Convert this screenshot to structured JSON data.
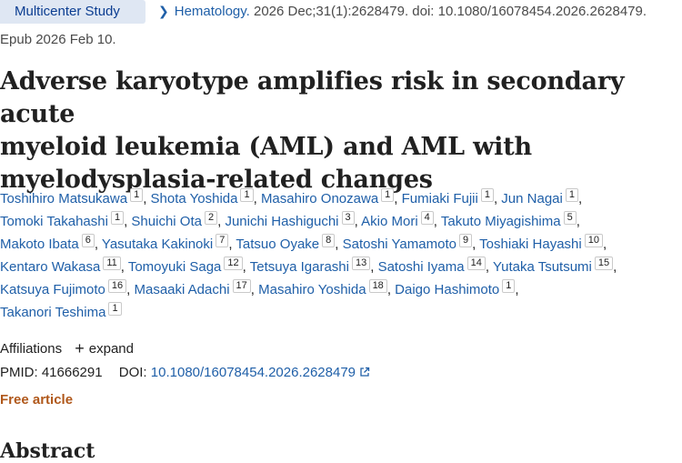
{
  "header": {
    "badge": "Multicenter Study",
    "journal": "Hematology.",
    "citation": " 2026 Dec;31(1):2628479. doi: 10.1080/16078454.2026.2628479.",
    "epub": "Epub 2026 Feb 10."
  },
  "title": {
    "line1": "Adverse karyotype amplifies risk in secondary acute",
    "line2": "myeloid leukemia (AML) and AML with",
    "line3": "myelodysplasia-related changes"
  },
  "authors": [
    {
      "name": "Toshihiro Matsukawa",
      "aff": "1"
    },
    {
      "name": "Shota Yoshida",
      "aff": "1"
    },
    {
      "name": "Masahiro Onozawa",
      "aff": "1"
    },
    {
      "name": "Fumiaki Fujii",
      "aff": "1"
    },
    {
      "name": "Jun Nagai",
      "aff": "1"
    },
    {
      "name": "Tomoki Takahashi",
      "aff": "1"
    },
    {
      "name": "Shuichi Ota",
      "aff": "2"
    },
    {
      "name": "Junichi Hashiguchi",
      "aff": "3"
    },
    {
      "name": "Akio Mori",
      "aff": "4"
    },
    {
      "name": "Takuto Miyagishima",
      "aff": "5"
    },
    {
      "name": "Makoto Ibata",
      "aff": "6"
    },
    {
      "name": "Yasutaka Kakinoki",
      "aff": "7"
    },
    {
      "name": "Tatsuo Oyake",
      "aff": "8"
    },
    {
      "name": "Satoshi Yamamoto",
      "aff": "9"
    },
    {
      "name": "Toshiaki Hayashi",
      "aff": "10"
    },
    {
      "name": "Kentaro Wakasa",
      "aff": "11"
    },
    {
      "name": "Tomoyuki Saga",
      "aff": "12"
    },
    {
      "name": "Tetsuya Igarashi",
      "aff": "13"
    },
    {
      "name": "Satoshi Iyama",
      "aff": "14"
    },
    {
      "name": "Yutaka Tsutsumi",
      "aff": "15"
    },
    {
      "name": "Katsuya Fujimoto",
      "aff": "16"
    },
    {
      "name": "Masaaki Adachi",
      "aff": "17"
    },
    {
      "name": "Masahiro Yoshida",
      "aff": "18"
    },
    {
      "name": "Daigo Hashimoto",
      "aff": "1"
    },
    {
      "name": "Takanori Teshima",
      "aff": "1"
    }
  ],
  "affiliations": {
    "label": "Affiliations",
    "expand_icon": "+",
    "expand_label": "expand"
  },
  "ids": {
    "pmid_label": "PMID:",
    "pmid": "41666291",
    "doi_label": "DOI:",
    "doi": "10.1080/16078454.2026.2628479"
  },
  "free_article": "Free article",
  "abstract_heading": "Abstract",
  "icons": {
    "breadcrumb": "chevron-right-icon",
    "external": "external-link-icon"
  },
  "colors": {
    "link": "#1f5fa8",
    "badge_bg": "#dfe7f3",
    "free_article": "#b0581b"
  }
}
